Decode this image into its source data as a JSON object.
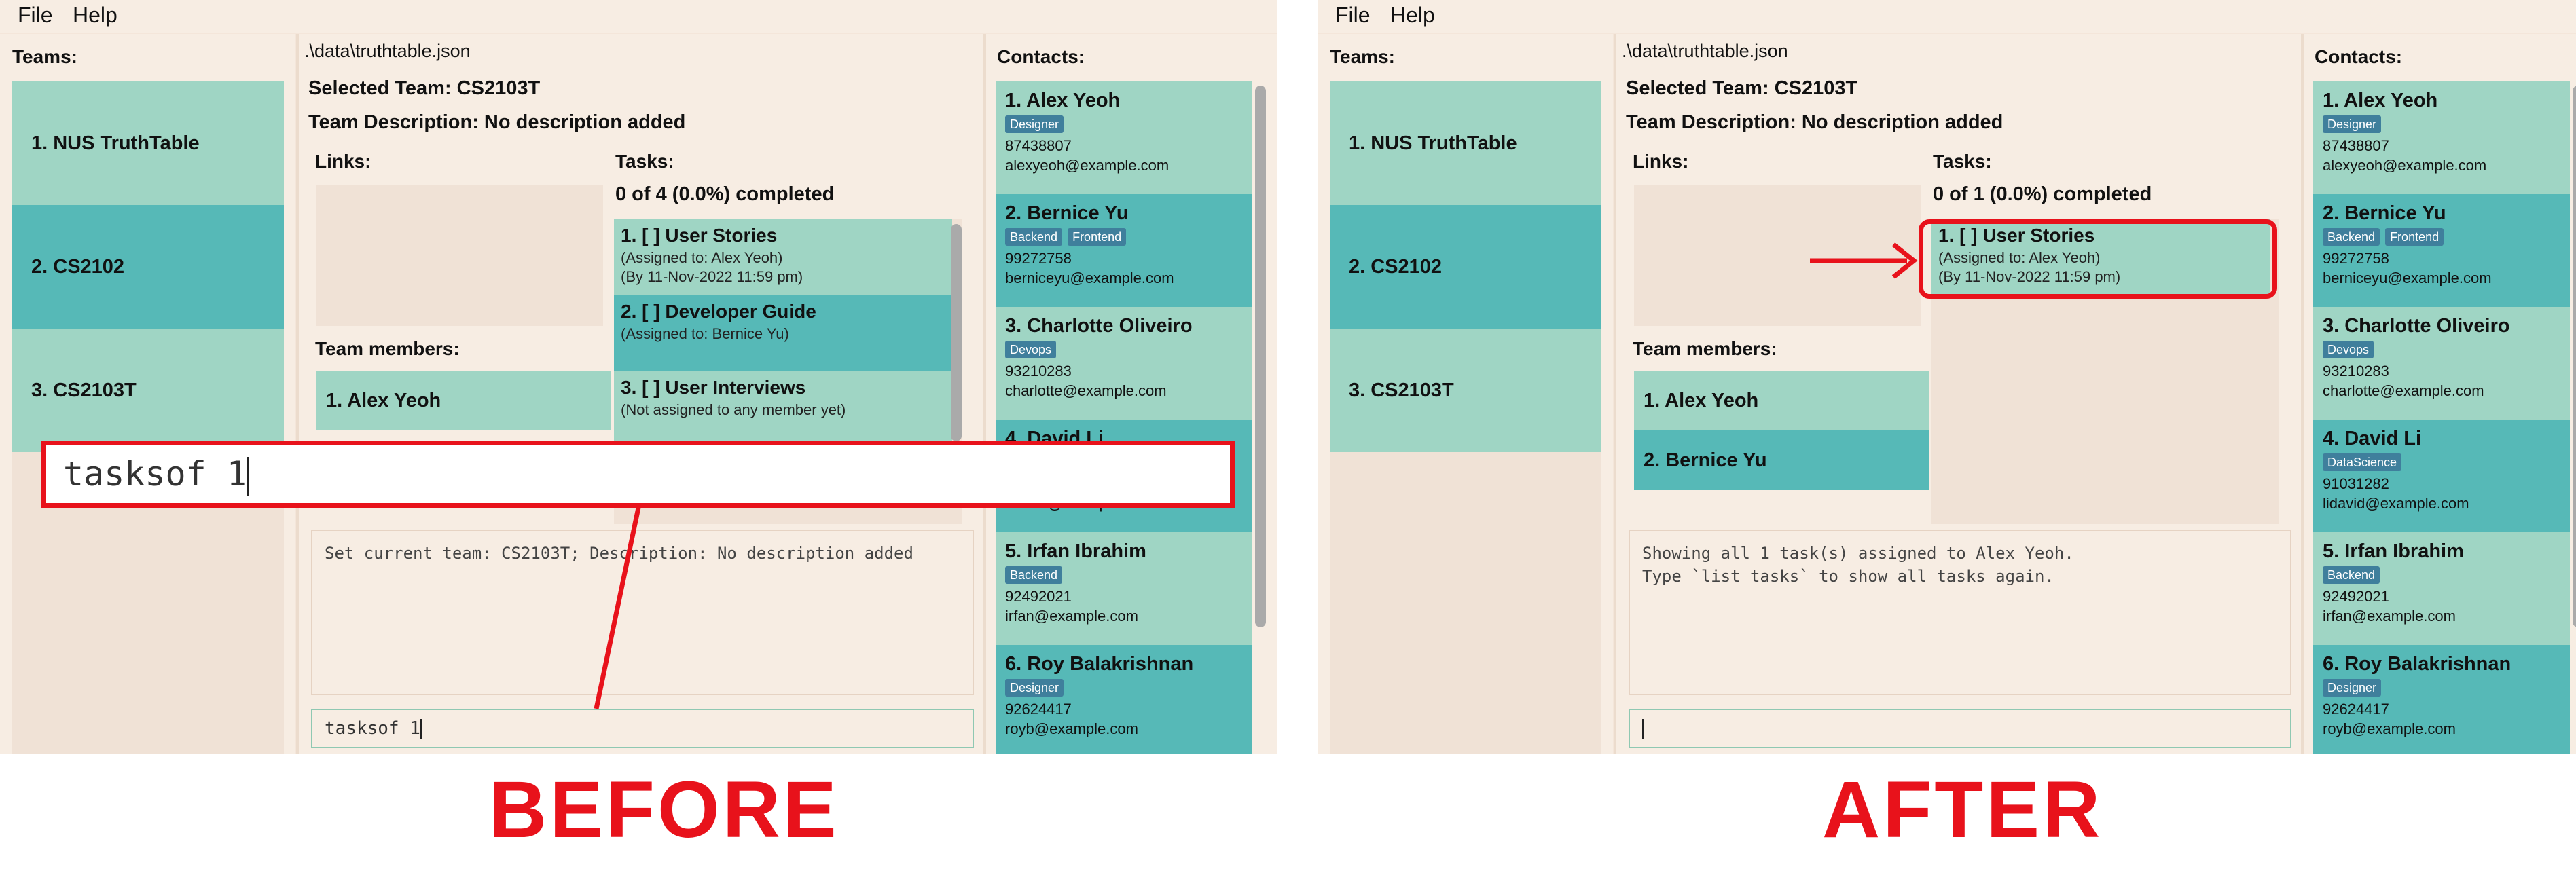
{
  "menu": {
    "file": "File",
    "help": "Help"
  },
  "teams_label": "Teams:",
  "teams": [
    "1. NUS TruthTable",
    "2. CS2102",
    "3. CS2103T"
  ],
  "path": ".\\data\\truthtable.json",
  "selected_team": "Selected Team: CS2103T",
  "team_description": "Team Description: No description added",
  "links_label": "Links:",
  "tasks_label": "Tasks:",
  "team_members_label": "Team members:",
  "members": [
    "1. Alex Yeoh",
    "2. Bernice Yu"
  ],
  "contacts_label": "Contacts:",
  "contacts": [
    {
      "name": "1. Alex Yeoh",
      "tags": [
        "Designer"
      ],
      "phone": "87438807",
      "email": "alexyeoh@example.com"
    },
    {
      "name": "2. Bernice Yu",
      "tags": [
        "Backend",
        "Frontend"
      ],
      "phone": "99272758",
      "email": "berniceyu@example.com"
    },
    {
      "name": "3. Charlotte Oliveiro",
      "tags": [
        "Devops"
      ],
      "phone": "93210283",
      "email": "charlotte@example.com"
    },
    {
      "name": "4. David Li",
      "tags": [
        "DataScience"
      ],
      "phone": "91031282",
      "email": "lidavid@example.com"
    },
    {
      "name": "5. Irfan Ibrahim",
      "tags": [
        "Backend"
      ],
      "phone": "92492021",
      "email": "irfan@example.com"
    },
    {
      "name": "6. Roy Balakrishnan",
      "tags": [
        "Designer"
      ],
      "phone": "92624417",
      "email": "royb@example.com"
    }
  ],
  "before": {
    "tasks_count": "0 of 4 (0.0%) completed",
    "tasks": [
      {
        "title": "1. [ ] User Stories",
        "assigned": "(Assigned to: Alex Yeoh)",
        "deadline": "(By 11-Nov-2022 11:59 pm)"
      },
      {
        "title": "2. [ ] Developer Guide",
        "assigned": "(Assigned to: Bernice Yu)"
      },
      {
        "title": "3. [ ] User Interviews",
        "assigned": "(Not assigned to any member yet)"
      }
    ],
    "result": "Set current team: CS2103T; Description: No description added",
    "command": "tasksof 1",
    "zoomed_command": "tasksof 1"
  },
  "after": {
    "tasks_count": "0 of 1 (0.0%) completed",
    "tasks": [
      {
        "title": "1. [ ] User Stories",
        "assigned": "(Assigned to: Alex Yeoh)",
        "deadline": "(By 11-Nov-2022 11:59 pm)"
      }
    ],
    "result_line1": "Showing all 1 task(s) assigned to Alex Yeoh.",
    "result_line2": "Type `list tasks` to show all tasks again.",
    "command": ""
  },
  "captions": {
    "before": "BEFORE",
    "after": "AFTER"
  },
  "colors": {
    "accent_red": "#e8121b",
    "list_light": "#9fd5c4",
    "list_dark": "#56b9b7",
    "tag": "#3f7f9c",
    "background": "#f4e6da"
  }
}
